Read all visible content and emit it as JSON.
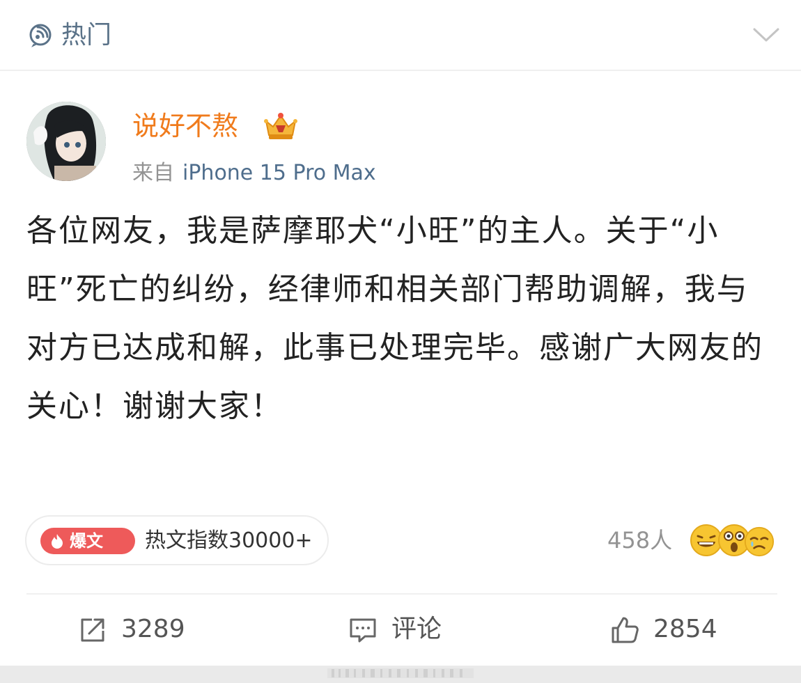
{
  "header": {
    "title": "热门",
    "icon": "hot-topic-icon",
    "collapse_icon": "chevron-down-icon"
  },
  "post": {
    "author": {
      "name": "说好不熬",
      "badge_icon": "crown-icon",
      "source_prefix": "来自",
      "device": "iPhone 15 Pro Max"
    },
    "content": "各位网友，我是萨摩耶犬“小旺”的主人。关于“小旺”死亡的纠纷，经律师和相关部门帮助调解，我与对方已达成和解，此事已处理完毕。感谢广大网友的关心！谢谢大家！",
    "hot_badge": {
      "tag": "爆文",
      "text": "热文指数30000+"
    },
    "reactions": {
      "count_text": "458人",
      "emojis": [
        "laughing-emoji",
        "shocked-emoji",
        "crying-emoji"
      ]
    }
  },
  "actions": {
    "repost": "3289",
    "comment": "评论",
    "like": "2854"
  },
  "colors": {
    "author_name": "#f07b1c",
    "device": "#4e6d8c",
    "hot_tag": "#ee5a5a",
    "header_title": "#5a7288"
  }
}
